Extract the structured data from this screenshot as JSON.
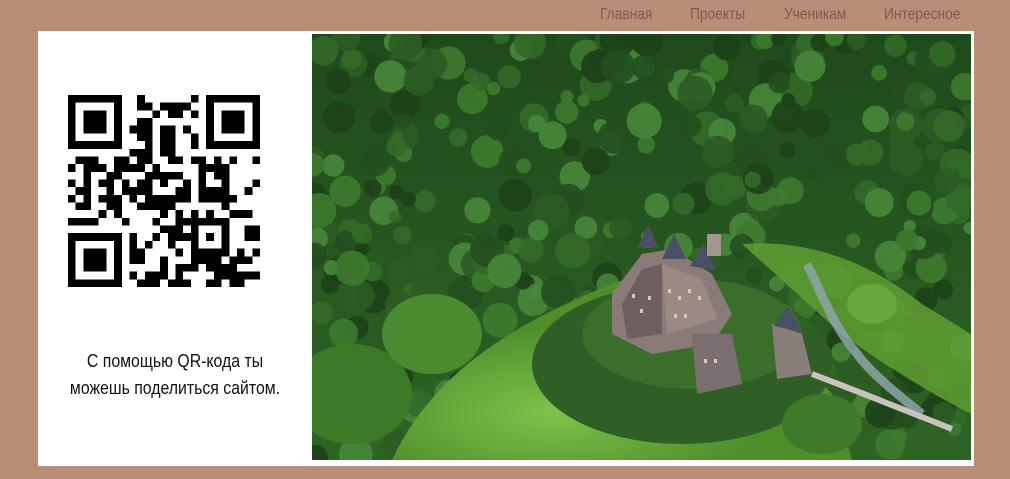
{
  "nav": {
    "items": [
      "Главная",
      "Проекты",
      "Ученикам",
      "Интересное"
    ]
  },
  "qr": {
    "caption_line1": "С помощью QR-кода ты",
    "caption_line2": "можешь поделиться сайтом."
  },
  "image": {
    "subject": "castle-in-forest-photo"
  },
  "colors": {
    "page_background": "#b88e76",
    "nav_text": "#7a5d50",
    "panel": "#ffffff"
  }
}
